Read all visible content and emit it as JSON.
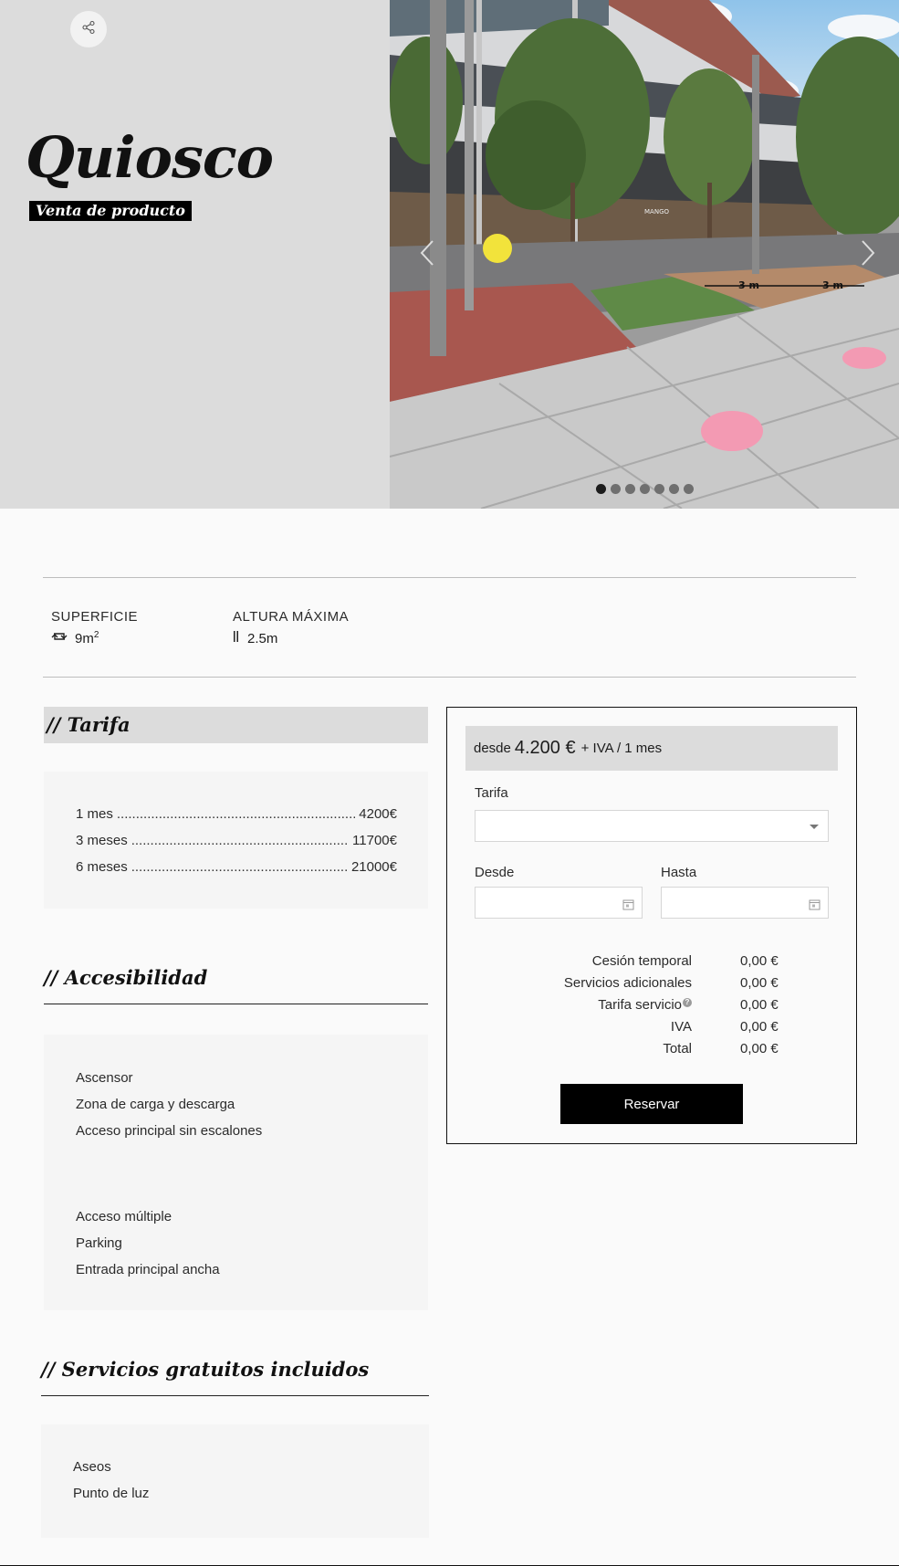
{
  "hero": {
    "title": "Quiosco",
    "subtitle": "Venta de producto",
    "share_icon": "share-icon",
    "photo_signs": {
      "dimension_left": "3 m",
      "dimension_right": "3 m",
      "store_sign": "MANGO"
    },
    "carousel": {
      "total_slides": 7,
      "active_index": 0
    }
  },
  "specs": [
    {
      "label": "SUPERFICIE",
      "icon": "repeat-icon",
      "value": "9m",
      "superscript": "2"
    },
    {
      "label": "ALTURA MÁXIMA",
      "icon": "height-bars-icon",
      "value": "2.5m"
    }
  ],
  "tarifa": {
    "heading_prefix": "//",
    "heading": "Tarifa",
    "rates": [
      {
        "period": "1 mes",
        "price": "4200€"
      },
      {
        "period": "3 meses",
        "price": "11700€"
      },
      {
        "period": "6 meses",
        "price": "21000€"
      }
    ]
  },
  "accesibilidad": {
    "heading_prefix": "//",
    "heading": "Accesibilidad",
    "group1": [
      "Ascensor",
      "Zona de carga y descarga",
      "Acceso principal sin escalones"
    ],
    "group2": [
      "Acceso múltiple",
      "Parking",
      "Entrada principal ancha"
    ]
  },
  "servicios": {
    "heading_prefix": "//",
    "heading": "Servicios gratuitos incluidos",
    "items": [
      "Aseos",
      "Punto de luz"
    ]
  },
  "booking": {
    "price_prefix": "desde",
    "price": "4.200 €",
    "price_suffix": "+ IVA / 1 mes",
    "tarifa_label": "Tarifa",
    "tarifa_value": "",
    "desde_label": "Desde",
    "hasta_label": "Hasta",
    "totals": [
      {
        "label": "Cesión temporal",
        "value": "0,00 €"
      },
      {
        "label": "Servicios adicionales",
        "value": "0,00 €"
      },
      {
        "label": "Tarifa servicio",
        "value": "0,00 €",
        "help": "?"
      },
      {
        "label": "IVA",
        "value": "0,00 €"
      },
      {
        "label": "Total",
        "value": "0,00 €"
      }
    ],
    "reserve_label": "Reservar"
  }
}
